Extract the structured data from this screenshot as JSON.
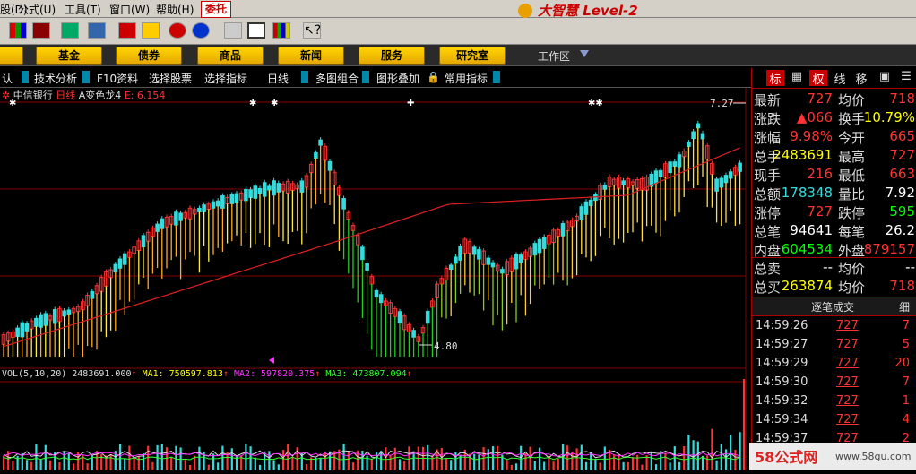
{
  "menu": {
    "items": [
      "股(D)",
      "公式(U)",
      "工具(T)",
      "窗口(W)",
      "帮助(H)"
    ],
    "delegate": "委托",
    "app_title": "大智慧 Level-2"
  },
  "navbar": {
    "buttons": [
      "",
      "基金",
      "债券",
      "商品",
      "新闻",
      "服务",
      "研究室"
    ],
    "workarea": "工作区"
  },
  "tabs": [
    "认",
    "技术分析",
    "F10资料",
    "选择股票",
    "选择指标",
    "日线",
    "多图组合",
    "图形叠加",
    "常用指标"
  ],
  "chart_header": {
    "stock": "中信银行",
    "period": "日线",
    "indicator": "A变色龙4",
    "e_label": "E: 6.154"
  },
  "price_chart": {
    "high_label": "7.27",
    "low_label": "4.80"
  },
  "volume_header": {
    "vol": "VOL(5,10,20) 2483691.000",
    "ma1": "MA1: 750597.813",
    "ma2": "MA2: 597820.375",
    "ma3": "MA3: 473807.094"
  },
  "colors": {
    "up": "#ff3333",
    "down": "#33dddd",
    "gold": "#ffff00",
    "green": "#00ff00"
  },
  "right_panel": {
    "tabs": [
      "标",
      "",
      "权",
      "线",
      "移",
      "",
      ""
    ],
    "quote": [
      {
        "l1": "最新",
        "v1": "727",
        "l2": "均价",
        "v2": "718",
        "c1": "#ff3333",
        "c2": "#ff3333"
      },
      {
        "l1": "涨跌",
        "v1": "▲066",
        "l2": "换手",
        "v2": "10.79%",
        "c1": "#ff3333",
        "c2": "#ffff00"
      },
      {
        "l1": "涨幅",
        "v1": "9.98%",
        "l2": "今开",
        "v2": "665",
        "c1": "#ff3333",
        "c2": "#ff3333"
      },
      {
        "l1": "总手",
        "v1": "2483691",
        "l2": "最高",
        "v2": "727",
        "c1": "#ffff00",
        "c2": "#ff3333"
      },
      {
        "l1": "现手",
        "v1": "216",
        "l2": "最低",
        "v2": "663",
        "c1": "#ff3333",
        "c2": "#ff3333"
      },
      {
        "l1": "总额",
        "v1": "178348",
        "l2": "量比",
        "v2": "7.92",
        "c1": "#33dddd",
        "c2": "#ffffff"
      },
      {
        "l1": "涨停",
        "v1": "727",
        "l2": "跌停",
        "v2": "595",
        "c1": "#ff3333",
        "c2": "#00ff00"
      },
      {
        "l1": "总笔",
        "v1": "94641",
        "l2": "每笔",
        "v2": "26.2",
        "c1": "#ffffff",
        "c2": "#ffffff"
      },
      {
        "l1": "内盘",
        "v1": "604534",
        "l2": "外盘",
        "v2": "879157",
        "c1": "#00ff00",
        "c2": "#ff3333"
      }
    ],
    "order": [
      {
        "l1": "总卖",
        "v1": "--",
        "l2": "均价",
        "v2": "--",
        "c1": "#ffffff",
        "c2": "#ffffff"
      },
      {
        "l1": "总买",
        "v1": "263874",
        "l2": "均价",
        "v2": "718",
        "c1": "#ffff00",
        "c2": "#ff3333"
      }
    ],
    "ticks_header": "逐笔成交",
    "ticks_header2": "细",
    "ticks": [
      {
        "time": "14:59:26",
        "price": "727",
        "vol": "7"
      },
      {
        "time": "14:59:27",
        "price": "727",
        "vol": "5"
      },
      {
        "time": "14:59:29",
        "price": "727",
        "vol": "20"
      },
      {
        "time": "14:59:30",
        "price": "727",
        "vol": "7"
      },
      {
        "time": "14:59:32",
        "price": "727",
        "vol": "1"
      },
      {
        "time": "14:59:34",
        "price": "727",
        "vol": "4"
      },
      {
        "time": "14:59:37",
        "price": "727",
        "vol": "2"
      }
    ]
  },
  "watermark": {
    "brand": "58公式网",
    "url": "www.58gu.com"
  }
}
